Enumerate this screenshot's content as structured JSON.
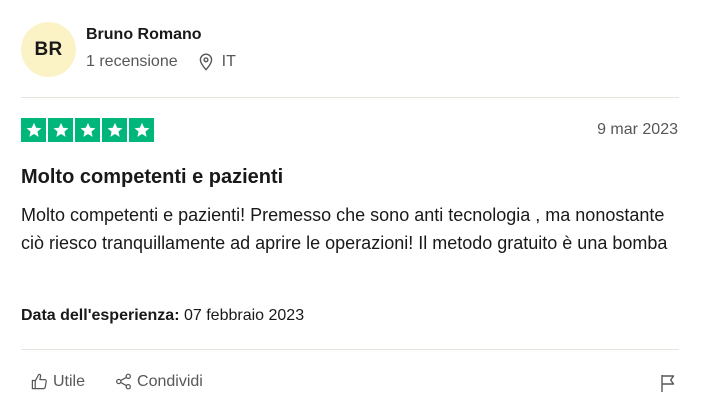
{
  "reviewer": {
    "initials": "BR",
    "name": "Bruno Romano",
    "review_count": "1 recensione",
    "country": "IT"
  },
  "review": {
    "rating": 5,
    "max_rating": 5,
    "date": "9 mar 2023",
    "title": "Molto competenti e pazienti",
    "body": "Molto competenti e pazienti! Premesso che sono anti tecnologia , ma nonostante ciò riesco tranquillamente ad aprire le operazioni! Il metodo gratuito è una bomba",
    "experience_label": "Data dell'esperienza:",
    "experience_date": "07 febbraio 2023"
  },
  "actions": {
    "useful_label": "Utile",
    "share_label": "Condividi"
  },
  "colors": {
    "star_green": "#00b67a",
    "avatar_bg": "#fbf3c6",
    "muted_text": "#575757"
  }
}
